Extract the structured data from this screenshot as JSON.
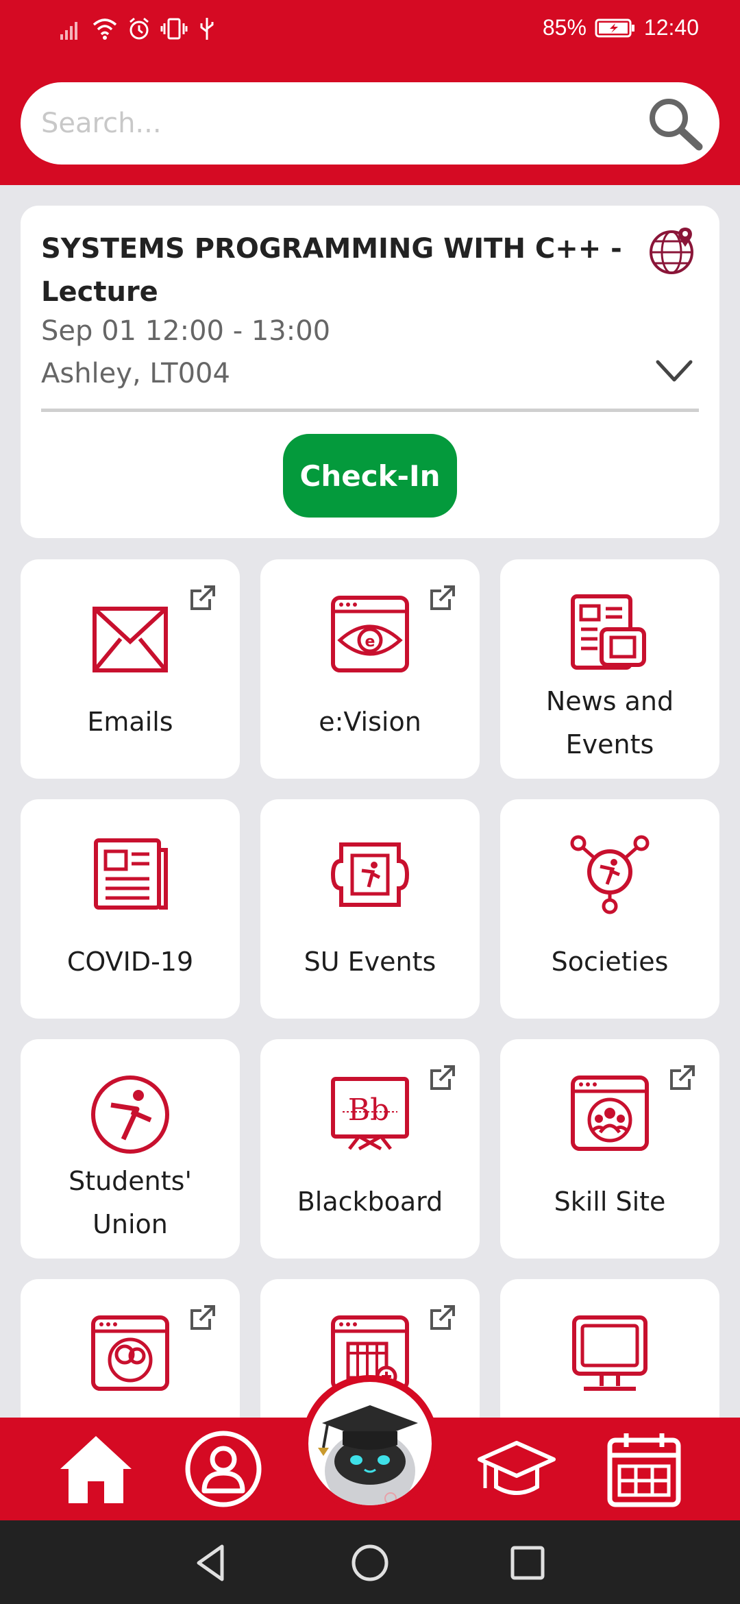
{
  "status_bar": {
    "battery": "85%",
    "time": "12:40"
  },
  "search": {
    "placeholder": "Search..."
  },
  "lecture": {
    "title": "SYSTEMS PROGRAMMING WITH C++ - Lecture",
    "time": "Sep 01 12:00 - 13:00",
    "location": "Ashley, LT004",
    "checkin_label": "Check-In"
  },
  "tiles": [
    {
      "label": "Emails",
      "icon": "email-icon",
      "external": true
    },
    {
      "label": "e:Vision",
      "icon": "evision-icon",
      "external": true
    },
    {
      "label": "News and Events",
      "icon": "news-icon",
      "external": false
    },
    {
      "label": "COVID-19",
      "icon": "covid-news-icon",
      "external": false
    },
    {
      "label": "SU Events",
      "icon": "ticket-icon",
      "external": false
    },
    {
      "label": "Societies",
      "icon": "societies-icon",
      "external": false
    },
    {
      "label": "Students' Union",
      "icon": "students-union-icon",
      "external": false
    },
    {
      "label": "Blackboard",
      "icon": "blackboard-icon",
      "external": true
    },
    {
      "label": "Skill Site",
      "icon": "skill-site-icon",
      "external": true
    },
    {
      "label": "",
      "icon": "people-window-icon",
      "external": true
    },
    {
      "label": "",
      "icon": "calendar-window-icon",
      "external": true
    },
    {
      "label": "",
      "icon": "monitor-icon",
      "external": false
    }
  ],
  "bottom_nav": [
    "home-icon",
    "profile-icon",
    "chatbot-icon",
    "graduation-cap-icon",
    "calendar-icon"
  ],
  "colors": {
    "brand_red": "#d50a23",
    "checkin_green": "#049a3c",
    "background": "#e6e6ea"
  }
}
